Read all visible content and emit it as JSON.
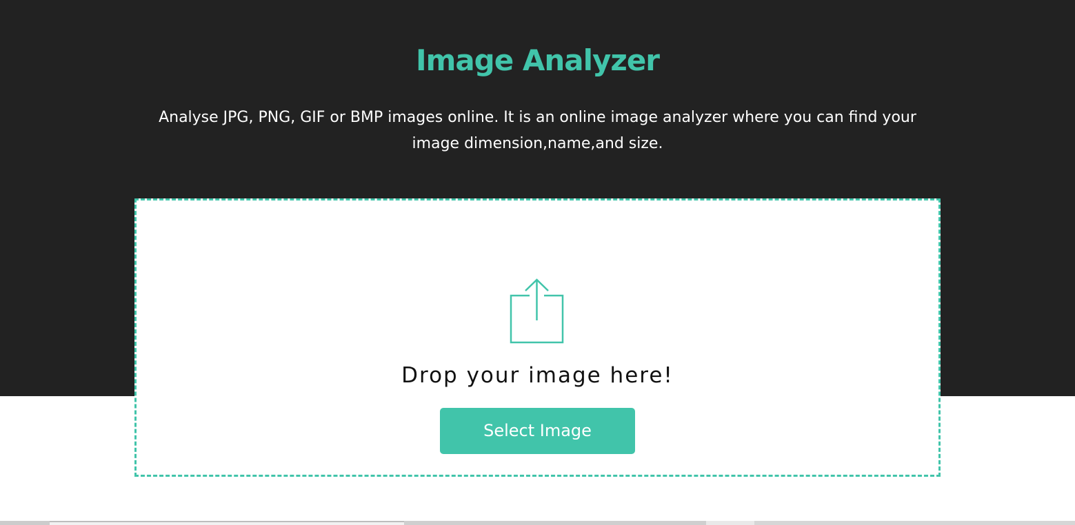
{
  "header": {
    "title": "Image Analyzer",
    "description": "Analyse JPG, PNG, GIF or BMP images online. It is an online image analyzer where you can find your image dimension,name,and size."
  },
  "dropzone": {
    "icon": "upload-icon",
    "prompt": "Drop your image here!",
    "button_label": "Select Image"
  },
  "colors": {
    "accent": "#41c4aa",
    "hero_background": "#222222",
    "page_background": "#ffffff",
    "description_text": "#ffffff"
  }
}
